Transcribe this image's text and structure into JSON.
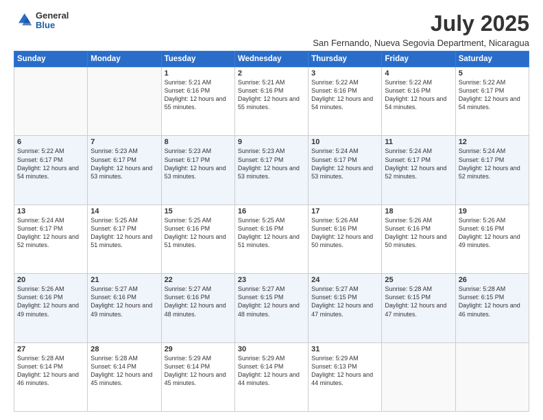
{
  "logo": {
    "general": "General",
    "blue": "Blue"
  },
  "header": {
    "title": "July 2025",
    "subtitle": "San Fernando, Nueva Segovia Department, Nicaragua"
  },
  "days_of_week": [
    "Sunday",
    "Monday",
    "Tuesday",
    "Wednesday",
    "Thursday",
    "Friday",
    "Saturday"
  ],
  "weeks": [
    [
      {
        "day": "",
        "info": ""
      },
      {
        "day": "",
        "info": ""
      },
      {
        "day": "1",
        "info": "Sunrise: 5:21 AM\nSunset: 6:16 PM\nDaylight: 12 hours and 55 minutes."
      },
      {
        "day": "2",
        "info": "Sunrise: 5:21 AM\nSunset: 6:16 PM\nDaylight: 12 hours and 55 minutes."
      },
      {
        "day": "3",
        "info": "Sunrise: 5:22 AM\nSunset: 6:16 PM\nDaylight: 12 hours and 54 minutes."
      },
      {
        "day": "4",
        "info": "Sunrise: 5:22 AM\nSunset: 6:16 PM\nDaylight: 12 hours and 54 minutes."
      },
      {
        "day": "5",
        "info": "Sunrise: 5:22 AM\nSunset: 6:17 PM\nDaylight: 12 hours and 54 minutes."
      }
    ],
    [
      {
        "day": "6",
        "info": "Sunrise: 5:22 AM\nSunset: 6:17 PM\nDaylight: 12 hours and 54 minutes."
      },
      {
        "day": "7",
        "info": "Sunrise: 5:23 AM\nSunset: 6:17 PM\nDaylight: 12 hours and 53 minutes."
      },
      {
        "day": "8",
        "info": "Sunrise: 5:23 AM\nSunset: 6:17 PM\nDaylight: 12 hours and 53 minutes."
      },
      {
        "day": "9",
        "info": "Sunrise: 5:23 AM\nSunset: 6:17 PM\nDaylight: 12 hours and 53 minutes."
      },
      {
        "day": "10",
        "info": "Sunrise: 5:24 AM\nSunset: 6:17 PM\nDaylight: 12 hours and 53 minutes."
      },
      {
        "day": "11",
        "info": "Sunrise: 5:24 AM\nSunset: 6:17 PM\nDaylight: 12 hours and 52 minutes."
      },
      {
        "day": "12",
        "info": "Sunrise: 5:24 AM\nSunset: 6:17 PM\nDaylight: 12 hours and 52 minutes."
      }
    ],
    [
      {
        "day": "13",
        "info": "Sunrise: 5:24 AM\nSunset: 6:17 PM\nDaylight: 12 hours and 52 minutes."
      },
      {
        "day": "14",
        "info": "Sunrise: 5:25 AM\nSunset: 6:17 PM\nDaylight: 12 hours and 51 minutes."
      },
      {
        "day": "15",
        "info": "Sunrise: 5:25 AM\nSunset: 6:16 PM\nDaylight: 12 hours and 51 minutes."
      },
      {
        "day": "16",
        "info": "Sunrise: 5:25 AM\nSunset: 6:16 PM\nDaylight: 12 hours and 51 minutes."
      },
      {
        "day": "17",
        "info": "Sunrise: 5:26 AM\nSunset: 6:16 PM\nDaylight: 12 hours and 50 minutes."
      },
      {
        "day": "18",
        "info": "Sunrise: 5:26 AM\nSunset: 6:16 PM\nDaylight: 12 hours and 50 minutes."
      },
      {
        "day": "19",
        "info": "Sunrise: 5:26 AM\nSunset: 6:16 PM\nDaylight: 12 hours and 49 minutes."
      }
    ],
    [
      {
        "day": "20",
        "info": "Sunrise: 5:26 AM\nSunset: 6:16 PM\nDaylight: 12 hours and 49 minutes."
      },
      {
        "day": "21",
        "info": "Sunrise: 5:27 AM\nSunset: 6:16 PM\nDaylight: 12 hours and 49 minutes."
      },
      {
        "day": "22",
        "info": "Sunrise: 5:27 AM\nSunset: 6:16 PM\nDaylight: 12 hours and 48 minutes."
      },
      {
        "day": "23",
        "info": "Sunrise: 5:27 AM\nSunset: 6:15 PM\nDaylight: 12 hours and 48 minutes."
      },
      {
        "day": "24",
        "info": "Sunrise: 5:27 AM\nSunset: 6:15 PM\nDaylight: 12 hours and 47 minutes."
      },
      {
        "day": "25",
        "info": "Sunrise: 5:28 AM\nSunset: 6:15 PM\nDaylight: 12 hours and 47 minutes."
      },
      {
        "day": "26",
        "info": "Sunrise: 5:28 AM\nSunset: 6:15 PM\nDaylight: 12 hours and 46 minutes."
      }
    ],
    [
      {
        "day": "27",
        "info": "Sunrise: 5:28 AM\nSunset: 6:14 PM\nDaylight: 12 hours and 46 minutes."
      },
      {
        "day": "28",
        "info": "Sunrise: 5:28 AM\nSunset: 6:14 PM\nDaylight: 12 hours and 45 minutes."
      },
      {
        "day": "29",
        "info": "Sunrise: 5:29 AM\nSunset: 6:14 PM\nDaylight: 12 hours and 45 minutes."
      },
      {
        "day": "30",
        "info": "Sunrise: 5:29 AM\nSunset: 6:14 PM\nDaylight: 12 hours and 44 minutes."
      },
      {
        "day": "31",
        "info": "Sunrise: 5:29 AM\nSunset: 6:13 PM\nDaylight: 12 hours and 44 minutes."
      },
      {
        "day": "",
        "info": ""
      },
      {
        "day": "",
        "info": ""
      }
    ]
  ]
}
